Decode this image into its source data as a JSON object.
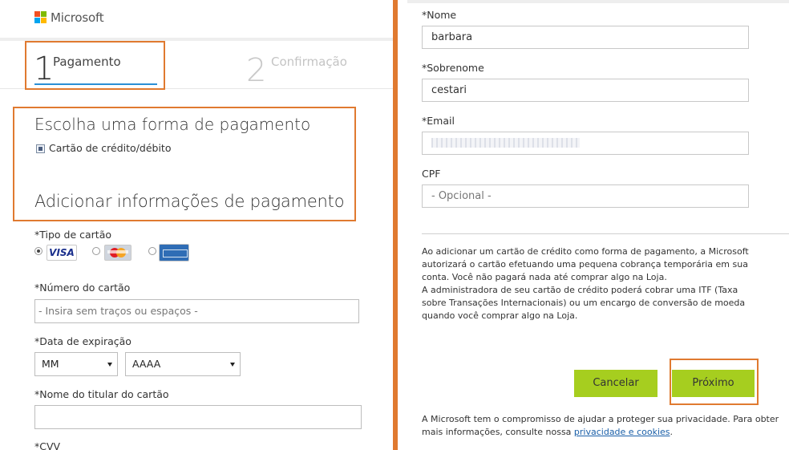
{
  "brand": {
    "name": "Microsoft"
  },
  "steps": [
    {
      "number": "1",
      "label": "Pagamento"
    },
    {
      "number": "2",
      "label": "Confirmação"
    }
  ],
  "payment_method": {
    "heading": "Escolha uma forma de pagamento",
    "option_label": "Cartão de crédito/débito",
    "option_checked": true
  },
  "add_info": {
    "heading": "Adicionar informações de pagamento"
  },
  "card_type": {
    "label": "*Tipo de cartão",
    "options": [
      {
        "name": "VISA",
        "selected": true
      },
      {
        "name": "mastercard",
        "selected": false
      },
      {
        "name": "american-express",
        "selected": false
      }
    ]
  },
  "card_number": {
    "label": "*Número do cartão",
    "placeholder": "- Insira sem traços ou espaços -"
  },
  "expiration": {
    "label": "*Data de expiração",
    "month": "MM",
    "year": "AAAA"
  },
  "holder": {
    "label": "*Nome do titular do cartão",
    "value": ""
  },
  "cvv": {
    "label": "*CVV"
  },
  "contact": {
    "first_name_label": "*Nome",
    "first_name_value": "barbara",
    "last_name_label": "*Sobrenome",
    "last_name_value": "cestari",
    "email_label": "*Email",
    "cpf_label": "CPF",
    "cpf_placeholder": "- Opcional -"
  },
  "legal_text": [
    "Ao adicionar um cartão de crédito como forma de pagamento, a Microsoft",
    "autorizará o cartão efetuando uma pequena cobrança temporária em sua",
    "conta. Você não pagará nada até comprar algo na Loja.",
    "A administradora de seu cartão de crédito poderá cobrar uma ITF (Taxa",
    "sobre Transações Internacionais) ou um encargo de conversão de moeda",
    "quando você comprar algo na Loja."
  ],
  "buttons": {
    "cancel": "Cancelar",
    "next": "Próximo"
  },
  "privacy": {
    "line1": "A Microsoft tem o compromisso de ajudar a proteger sua privacidade. Para obter",
    "line2": "mais informações, consulte nossa ",
    "link": "privacidade e cookies",
    "end": "."
  },
  "colors": {
    "highlight": "#e07a30",
    "button": "#a6ce1f",
    "step_active": "#2b8fd6"
  }
}
